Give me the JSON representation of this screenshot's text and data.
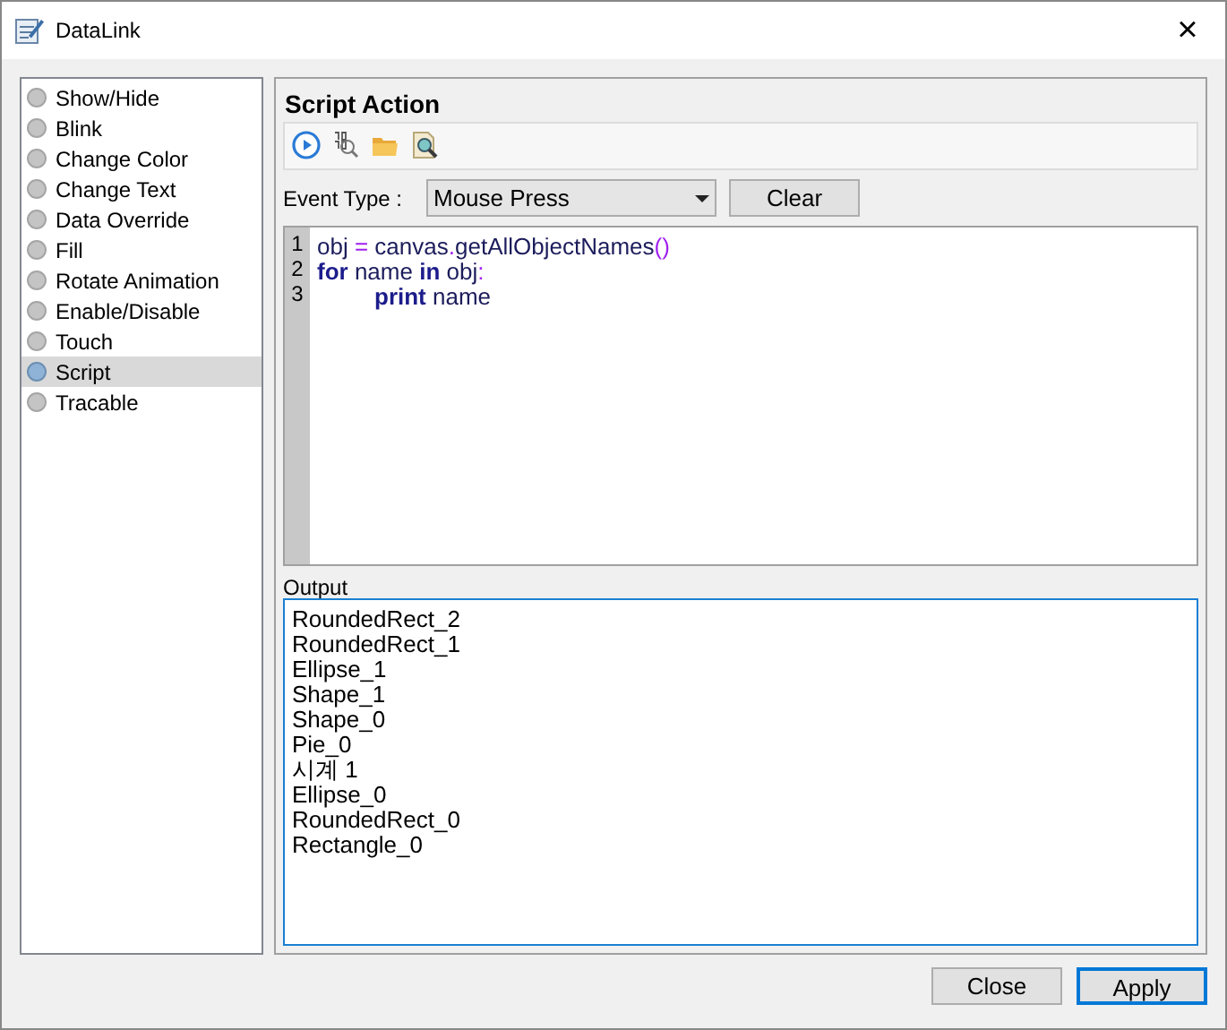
{
  "window": {
    "title": "DataLink",
    "close": "×"
  },
  "actions": [
    {
      "label": "Show/Hide",
      "selected": false
    },
    {
      "label": "Blink",
      "selected": false
    },
    {
      "label": "Change Color",
      "selected": false
    },
    {
      "label": "Change Text",
      "selected": false
    },
    {
      "label": "Data Override",
      "selected": false
    },
    {
      "label": "Fill",
      "selected": false
    },
    {
      "label": "Rotate Animation",
      "selected": false
    },
    {
      "label": "Enable/Disable",
      "selected": false
    },
    {
      "label": "Touch",
      "selected": false
    },
    {
      "label": "Script",
      "selected": true
    },
    {
      "label": "Tracable",
      "selected": false
    }
  ],
  "panel": {
    "title": "Script Action",
    "event_type": {
      "label": "Event Type :",
      "value": "Mouse Press"
    },
    "clear_button": "Clear",
    "editor": {
      "line_numbers": [
        "1",
        "2",
        "3"
      ],
      "lines": [
        {
          "indented": false,
          "tokens": [
            {
              "kind": "text",
              "text": "obj "
            },
            {
              "kind": "operator",
              "text": "="
            },
            {
              "kind": "text",
              "text": " canvas"
            },
            {
              "kind": "operator",
              "text": "."
            },
            {
              "kind": "text",
              "text": "getAllObjectNames"
            },
            {
              "kind": "operator",
              "text": "()"
            }
          ]
        },
        {
          "indented": false,
          "tokens": [
            {
              "kind": "keyword",
              "text": "for"
            },
            {
              "kind": "text",
              "text": " name "
            },
            {
              "kind": "keyword",
              "text": "in"
            },
            {
              "kind": "text",
              "text": " obj"
            },
            {
              "kind": "operator",
              "text": ":"
            }
          ]
        },
        {
          "indented": true,
          "tokens": [
            {
              "kind": "keyword",
              "text": "print"
            },
            {
              "kind": "text",
              "text": " name"
            }
          ]
        }
      ]
    },
    "output": {
      "label": "Output",
      "lines": [
        "RoundedRect_2",
        "RoundedRect_1",
        "Ellipse_1",
        "Shape_1",
        "Shape_0",
        "Pie_0",
        "시계 1",
        "Ellipse_0",
        "RoundedRect_0",
        "Rectangle_0"
      ]
    }
  },
  "buttons": [
    {
      "label": "Close",
      "focused": false
    },
    {
      "label": "Apply",
      "focused": true
    }
  ]
}
